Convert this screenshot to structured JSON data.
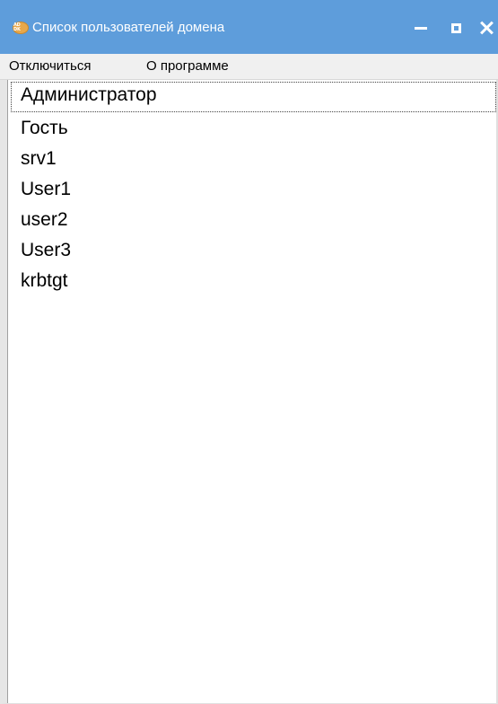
{
  "window": {
    "title": "Список пользователей домена",
    "icon": "app-logo-icon",
    "icon_text": "AD DK",
    "titlebar_color": "#5e9ddb"
  },
  "menu": {
    "items": [
      {
        "label": "Отключиться"
      },
      {
        "label": "О программе"
      }
    ]
  },
  "users": [
    {
      "name": "Администратор",
      "focused": true
    },
    {
      "name": "Гость"
    },
    {
      "name": "srv1"
    },
    {
      "name": "User1"
    },
    {
      "name": "user2"
    },
    {
      "name": "User3"
    },
    {
      "name": "krbtgt"
    }
  ]
}
